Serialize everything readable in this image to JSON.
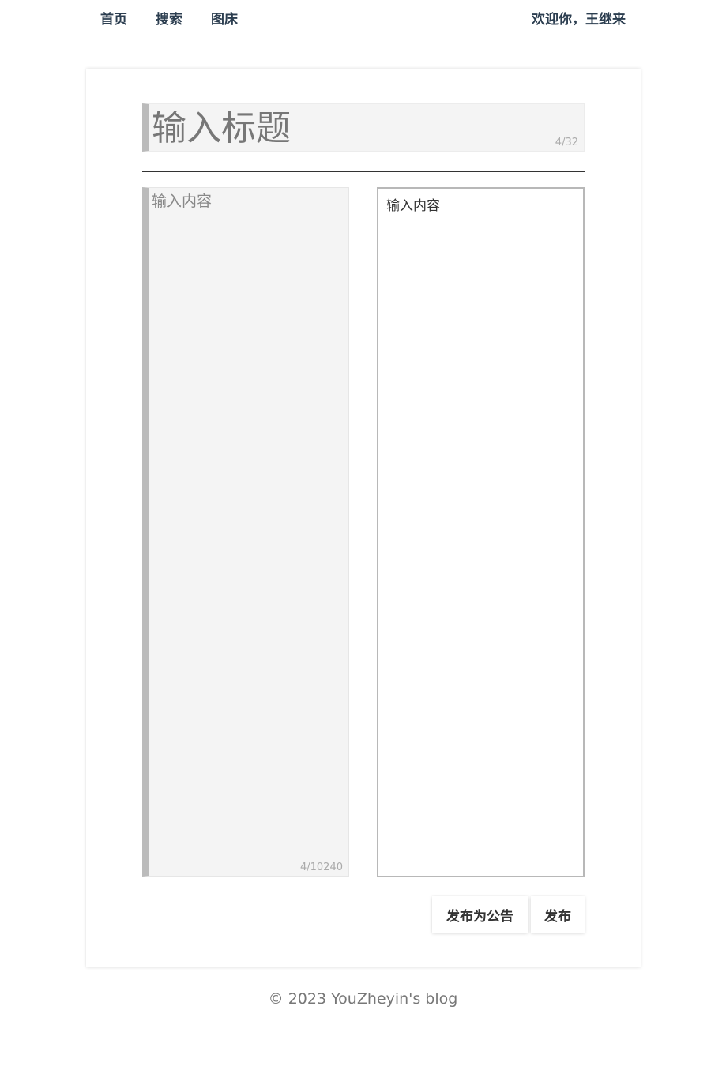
{
  "nav": {
    "home": "首页",
    "search": "搜索",
    "image_bed": "图床",
    "welcome": "欢迎你，王继来"
  },
  "editor": {
    "title_placeholder": "输入标题",
    "title_count": "4/32",
    "content_placeholder": "输入内容",
    "content_count": "4/10240",
    "preview_text": "输入内容"
  },
  "actions": {
    "publish_announcement": "发布为公告",
    "publish": "发布"
  },
  "footer": {
    "copyright": "© 2023 YouZheyin's blog"
  }
}
